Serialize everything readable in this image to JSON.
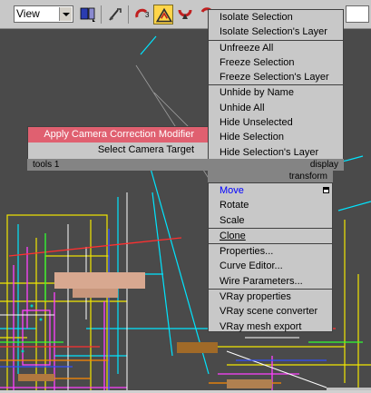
{
  "toolbar": {
    "view_select_value": "View",
    "icons": [
      "viewport-layout-icon",
      "snap-toggle-icon",
      "angle-snap-icon",
      "select-move-icon",
      "magnet-icon",
      "rotate-icon"
    ]
  },
  "quad_menu": {
    "top_right": {
      "items": [
        {
          "label": "Isolate Selection"
        },
        {
          "label": "Isolate Selection's Layer"
        },
        {
          "label": "Unfreeze All"
        },
        {
          "label": "Freeze Selection"
        },
        {
          "label": "Freeze Selection's Layer"
        },
        {
          "label": "Unhide by Name"
        },
        {
          "label": "Unhide All"
        },
        {
          "label": "Hide Unselected"
        },
        {
          "label": "Hide Selection"
        },
        {
          "label": "Hide Selection's Layer"
        }
      ],
      "header": "display"
    },
    "top_left": {
      "items": [
        {
          "label": "Apply Camera Correction Modifier"
        },
        {
          "label": "Select Camera Target"
        }
      ],
      "header": "tools 1"
    },
    "bottom_right": {
      "header": "transform",
      "items": [
        {
          "label": "Move"
        },
        {
          "label": "Rotate"
        },
        {
          "label": "Scale"
        },
        {
          "label": "Clone"
        },
        {
          "label": "Properties..."
        },
        {
          "label": "Curve Editor..."
        },
        {
          "label": "Wire Parameters..."
        },
        {
          "label": "VRay properties"
        },
        {
          "label": "VRay scene converter"
        },
        {
          "label": "VRay mesh export"
        }
      ]
    }
  },
  "colors": {
    "menu_bg": "#c8c8c8",
    "header_bg": "#848484",
    "hover_highlight": "#e06070",
    "active_item_text": "#0000ff",
    "active_tool": "#ffd54a"
  }
}
